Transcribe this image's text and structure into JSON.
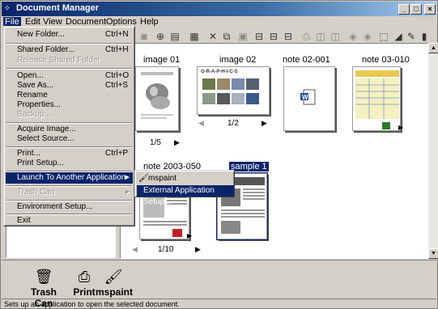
{
  "window": {
    "title": "Document Manager",
    "controls": [
      "_",
      "□",
      "×"
    ]
  },
  "menubar": [
    "File",
    "Edit",
    "View",
    "Document",
    "Options",
    "Help"
  ],
  "file_menu": [
    {
      "label": "New Folder...",
      "shortcut": "Ctrl+N",
      "enabled": true
    },
    {
      "label": "Shared Folder...",
      "shortcut": "Ctrl+H",
      "enabled": true
    },
    {
      "label": "Release Shared Folder",
      "shortcut": "",
      "enabled": false
    },
    {
      "label": "Open...",
      "shortcut": "Ctrl+O",
      "enabled": true
    },
    {
      "label": "Save As...",
      "shortcut": "Ctrl+S",
      "enabled": true
    },
    {
      "label": "Rename",
      "shortcut": "",
      "enabled": true
    },
    {
      "label": "Properties...",
      "shortcut": "",
      "enabled": true
    },
    {
      "label": "Backup...",
      "shortcut": "",
      "enabled": false
    },
    {
      "label": "Acquire Image...",
      "shortcut": "",
      "enabled": true
    },
    {
      "label": "Select Source...",
      "shortcut": "",
      "enabled": true
    },
    {
      "label": "Print...",
      "shortcut": "Ctrl+P",
      "enabled": true
    },
    {
      "label": "Print Setup...",
      "shortcut": "",
      "enabled": true
    },
    {
      "label": "Launch To Another Application",
      "shortcut": "",
      "enabled": true
    },
    {
      "label": "Trash Can",
      "shortcut": "",
      "enabled": false
    },
    {
      "label": "Environment Setup...",
      "shortcut": "",
      "enabled": true
    },
    {
      "label": "Exit",
      "shortcut": "",
      "enabled": true
    }
  ],
  "submenu": [
    {
      "label": "mspaint"
    },
    {
      "label": "External Application Setup..."
    }
  ],
  "documents": [
    {
      "name": "image 01",
      "page": "1/5"
    },
    {
      "name": "image 02",
      "page": "1/2",
      "thumb_text": "G-R-A-P-H-I-C-S"
    },
    {
      "name": "note 02-001",
      "page": ""
    },
    {
      "name": "note 03-010",
      "page": ""
    },
    {
      "name": "note 2003-050",
      "page": "1/10"
    },
    {
      "name": "sample 1",
      "page": ""
    }
  ],
  "tray": [
    {
      "label": "Trash Can",
      "icon": "trash-can-icon"
    },
    {
      "label": "Print",
      "icon": "printer-icon"
    },
    {
      "label": "mspaint",
      "icon": "paint-icon"
    }
  ],
  "status": "Sets up an application to open the selected document.",
  "colors": {
    "menu_highlight": "#0a246a",
    "face": "#d4d0c8"
  }
}
